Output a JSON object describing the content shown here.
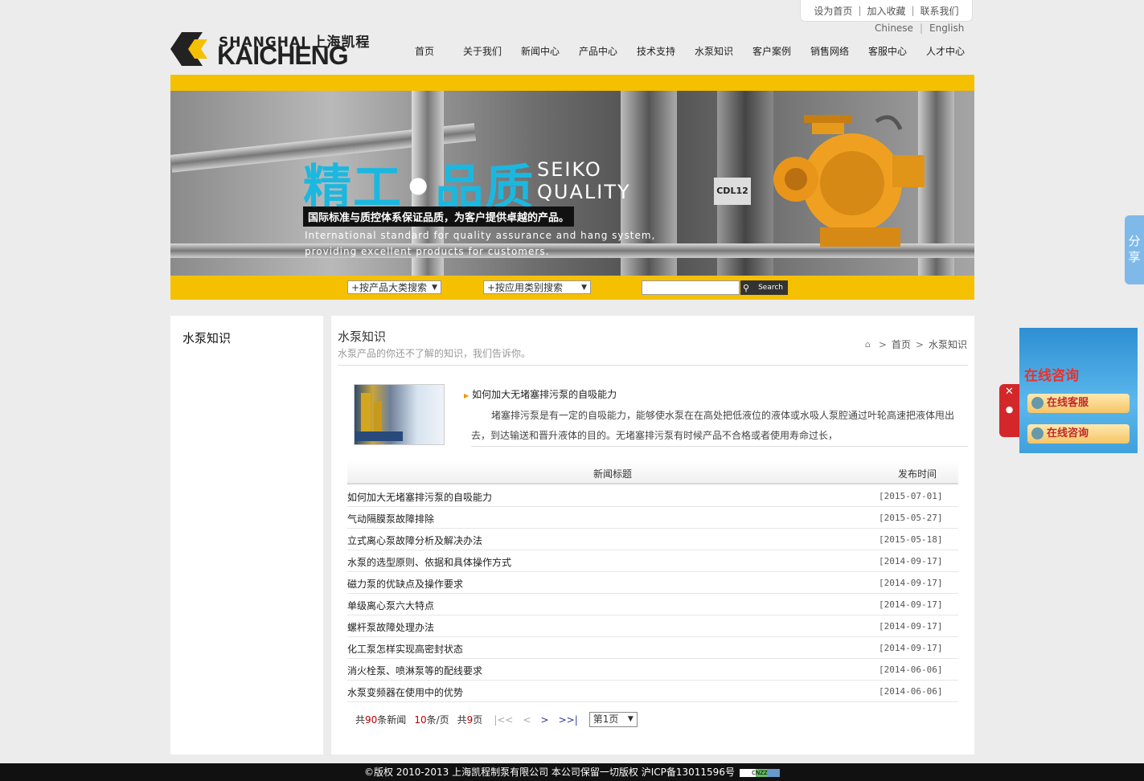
{
  "top_links": [
    "设为首页",
    "加入收藏",
    "联系我们"
  ],
  "lang": [
    "Chinese",
    "English"
  ],
  "logo": {
    "top": "SHANGHAI 上海凯程",
    "bottom": "KAICHENG"
  },
  "nav": [
    "首页",
    "关于我们",
    "新闻中心",
    "产品中心",
    "技术支持",
    "水泵知识",
    "客户案例",
    "销售网络",
    "客服中心",
    "人才中心"
  ],
  "banner": {
    "big_a": "精工",
    "big_b": "•",
    "big_c": "品质",
    "en_line1": "SEIKO",
    "en_line2": "QUALITY",
    "slogan": "国际标准与质控体系保证品质，为客户提供卓越的产品。",
    "en_desc1": "International standard for quality assurance and hang system,",
    "en_desc2": "providing excellent products for customers.",
    "pump_label": "CDL12"
  },
  "search": {
    "select1": "+按产品大类搜索",
    "select2": "+按应用类别搜索",
    "button": "Search"
  },
  "side": {
    "title": "水泵知识"
  },
  "main": {
    "title": "水泵知识",
    "subtitle": "水泵产品的你还不了解的知识，我们告诉你。",
    "breadcrumb": [
      "首页",
      "水泵知识"
    ],
    "featured": {
      "title": "如何加大无堵塞排污泵的自吸能力",
      "desc": "堵塞排污泵是有一定的自吸能力，能够使水泵在在高处把低液位的液体或水吸人泵腔通过叶轮高速把液体甩出去，到达输送和晋升液体的目的。无堵塞排污泵有时候产品不合格或者使用寿命过长，"
    },
    "table_head": {
      "title": "新闻标题",
      "date": "发布时间"
    },
    "rows": [
      {
        "title": "如何加大无堵塞排污泵的自吸能力",
        "date": "[2015-07-01]"
      },
      {
        "title": "气动隔膜泵故障排除",
        "date": "[2015-05-27]"
      },
      {
        "title": "立式离心泵故障分析及解决办法",
        "date": "[2015-05-18]"
      },
      {
        "title": "水泵的选型原则、依据和具体操作方式",
        "date": "[2014-09-17]"
      },
      {
        "title": "磁力泵的优缺点及操作要求",
        "date": "[2014-09-17]"
      },
      {
        "title": "单级离心泵六大特点",
        "date": "[2014-09-17]"
      },
      {
        "title": "螺杆泵故障处理办法",
        "date": "[2014-09-17]"
      },
      {
        "title": "化工泵怎样实现高密封状态",
        "date": "[2014-09-17]"
      },
      {
        "title": "消火栓泵、喷淋泵等的配线要求",
        "date": "[2014-06-06]"
      },
      {
        "title": "水泵变频器在使用中的优势",
        "date": "[2014-06-06]"
      }
    ],
    "pager": {
      "total_pre": "共",
      "total": "90",
      "total_post": "条新闻",
      "per": "10",
      "per_post": "条/页",
      "pages_pre": "共",
      "pages": "9",
      "pages_post": "页",
      "first": "|<<",
      "prev": "<",
      "next": ">",
      "last": ">>|",
      "page_select": "第1页"
    }
  },
  "footer": "©版权 2010-2013 上海凯程制泵有限公司 本公司保留一切版权 沪ICP备13011596号",
  "footer_badge": "CNZZ",
  "share": [
    "分",
    "享"
  ],
  "online": {
    "title": "在线咨询",
    "btn1": "在线客服",
    "btn2": "在线咨询"
  },
  "colors": {
    "accent": "#f5c000",
    "footer": "#111111",
    "cyan": "#1ab8e0"
  }
}
